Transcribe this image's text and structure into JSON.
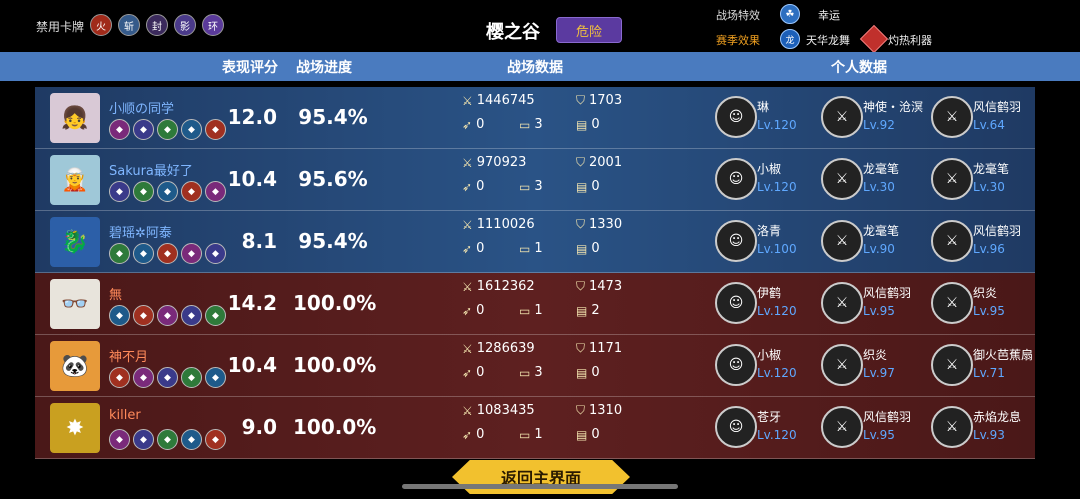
{
  "top": {
    "ban_label": "禁用卡牌",
    "ban_icons": [
      "火",
      "斩",
      "封",
      "影",
      "环"
    ],
    "map_name": "樱之谷",
    "danger": "危险",
    "field_effect_label": "战场特效",
    "field_effect_name": "幸运",
    "season_label": "赛季效果",
    "season_effect_1": "天华龙舞",
    "season_effect_2": "灼热利器"
  },
  "headers": {
    "score": "表现评分",
    "progress": "战场进度",
    "battle": "战场数据",
    "personal": "个人数据"
  },
  "colors": {
    "blue_team": "#2a5386",
    "red_team": "#5e2020",
    "header": "#4a7bbf",
    "button": "#f2c12e"
  },
  "players": [
    {
      "name": "小顺の同学",
      "score": "12.0",
      "progress": "95.4%",
      "damage": "1446745",
      "taken": "1703",
      "kills": "0",
      "book": "3",
      "chest": "0",
      "chars": [
        {
          "name": "琳",
          "lv": "Lv.120"
        },
        {
          "name": "神使・沧溟",
          "lv": "Lv.92"
        },
        {
          "name": "风信鹤羽",
          "lv": "Lv.64"
        }
      ]
    },
    {
      "name": "Sakura最好了",
      "score": "10.4",
      "progress": "95.6%",
      "damage": "970923",
      "taken": "2001",
      "kills": "0",
      "book": "3",
      "chest": "0",
      "chars": [
        {
          "name": "小椒",
          "lv": "Lv.120"
        },
        {
          "name": "龙毫笔",
          "lv": "Lv.30"
        },
        {
          "name": "龙毫笔",
          "lv": "Lv.30"
        }
      ]
    },
    {
      "name": "碧瑶✲阿泰",
      "score": "8.1",
      "progress": "95.4%",
      "damage": "1110026",
      "taken": "1330",
      "kills": "0",
      "book": "1",
      "chest": "0",
      "chars": [
        {
          "name": "洛青",
          "lv": "Lv.100"
        },
        {
          "name": "龙毫笔",
          "lv": "Lv.90"
        },
        {
          "name": "风信鹤羽",
          "lv": "Lv.96"
        }
      ]
    },
    {
      "name": "無",
      "score": "14.2",
      "progress": "100.0%",
      "damage": "1612362",
      "taken": "1473",
      "kills": "0",
      "book": "1",
      "chest": "2",
      "chars": [
        {
          "name": "伊鹤",
          "lv": "Lv.120"
        },
        {
          "name": "风信鹤羽",
          "lv": "Lv.95"
        },
        {
          "name": "织炎",
          "lv": "Lv.95"
        }
      ]
    },
    {
      "name": "神不月",
      "score": "10.4",
      "progress": "100.0%",
      "damage": "1286639",
      "taken": "1171",
      "kills": "0",
      "book": "3",
      "chest": "0",
      "chars": [
        {
          "name": "小椒",
          "lv": "Lv.120"
        },
        {
          "name": "织炎",
          "lv": "Lv.97"
        },
        {
          "name": "御火芭蕉扇",
          "lv": "Lv.71"
        }
      ]
    },
    {
      "name": "killer",
      "score": "9.0",
      "progress": "100.0%",
      "damage": "1083435",
      "taken": "1310",
      "kills": "0",
      "book": "1",
      "chest": "0",
      "chars": [
        {
          "name": "苍牙",
          "lv": "Lv.120"
        },
        {
          "name": "风信鹤羽",
          "lv": "Lv.95"
        },
        {
          "name": "赤焰龙息",
          "lv": "Lv.93"
        }
      ]
    }
  ],
  "return_button": "返回主界面"
}
